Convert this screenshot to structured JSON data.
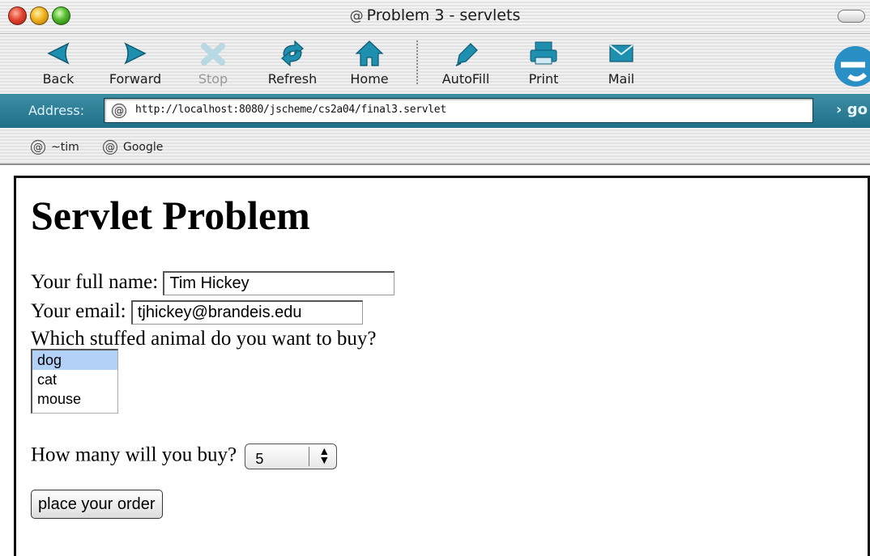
{
  "window": {
    "title": "Problem 3 - servlets"
  },
  "toolbar": {
    "back": "Back",
    "forward": "Forward",
    "stop": "Stop",
    "refresh": "Refresh",
    "home": "Home",
    "autofill": "AutoFill",
    "print": "Print",
    "mail": "Mail"
  },
  "address": {
    "label": "Address:",
    "url": "http://localhost:8080/jscheme/cs2a04/final3.servlet",
    "go": "go"
  },
  "favorites": [
    {
      "label": "~tim"
    },
    {
      "label": "Google"
    }
  ],
  "form": {
    "heading": "Servlet Problem",
    "name_label": "Your full name:",
    "name_value": "Tim Hickey",
    "email_label": "Your email:",
    "email_value": "tjhickey@brandeis.edu",
    "animal_question": "Which stuffed animal do you want to buy?",
    "animals": [
      "dog",
      "cat",
      "mouse"
    ],
    "selected_animal": "dog",
    "quantity_label": "How many will you buy?",
    "quantity_value": "5",
    "submit_label": "place your order"
  },
  "colors": {
    "address_bar": "#1e6f88",
    "selection": "#b3d0f7",
    "icon_teal": "#1f8fb0"
  },
  "icons": [
    "back-icon",
    "forward-icon",
    "stop-icon",
    "refresh-icon",
    "home-icon",
    "autofill-icon",
    "print-icon",
    "mail-icon",
    "ie-logo-icon",
    "at-icon"
  ]
}
